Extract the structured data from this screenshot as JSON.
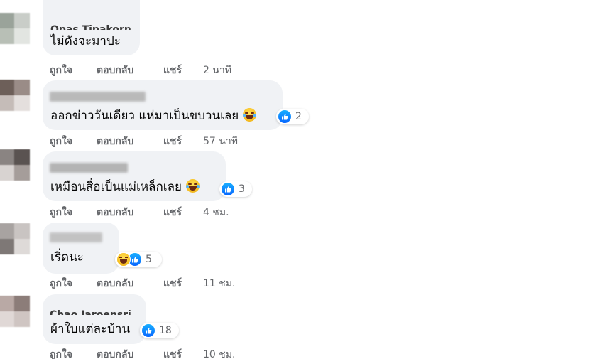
{
  "colors": {
    "bubble_bg": "#f0f2f5",
    "text": "#050505",
    "meta": "#65676b",
    "like_blue": "#0866ff"
  },
  "comments": [
    {
      "author": "Opas Tipakorn",
      "text": "ไม่ดังจะมาปะ",
      "emoji": null,
      "reactions": [],
      "reaction_count": null,
      "actions": {
        "like": "ถูกใจ",
        "reply": "ตอบกลับ",
        "share": "แชร์"
      },
      "time": "2 นาที"
    },
    {
      "author": "",
      "text": "ออกข่าววันเดียว แห่มาเป็นขบวนเลย",
      "emoji": "rolling-laughing-emoji",
      "reactions": [
        "like"
      ],
      "reaction_count": "2",
      "actions": {
        "like": "ถูกใจ",
        "reply": "ตอบกลับ",
        "share": "แชร์"
      },
      "time": "57 นาที"
    },
    {
      "author": "",
      "text": "เหมือนสื่อเป็นแม่เหล็กเลย",
      "emoji": "rolling-laughing-emoji",
      "reactions": [
        "like"
      ],
      "reaction_count": "3",
      "actions": {
        "like": "ถูกใจ",
        "reply": "ตอบกลับ",
        "share": "แชร์"
      },
      "time": "4 ชม."
    },
    {
      "author": "",
      "text": "เริ่ดนะ",
      "emoji": null,
      "reactions": [
        "haha",
        "like"
      ],
      "reaction_count": "5",
      "actions": {
        "like": "ถูกใจ",
        "reply": "ตอบกลับ",
        "share": "แชร์"
      },
      "time": "11 ชม."
    },
    {
      "author": "Chao Jaroensri",
      "text": "ผ้าใบแต่ละบ้าน",
      "emoji": null,
      "reactions": [
        "like"
      ],
      "reaction_count": "18",
      "actions": {
        "like": "ถูกใจ",
        "reply": "ตอบกลับ",
        "share": "แชร์"
      },
      "time": "10 ชม."
    }
  ]
}
